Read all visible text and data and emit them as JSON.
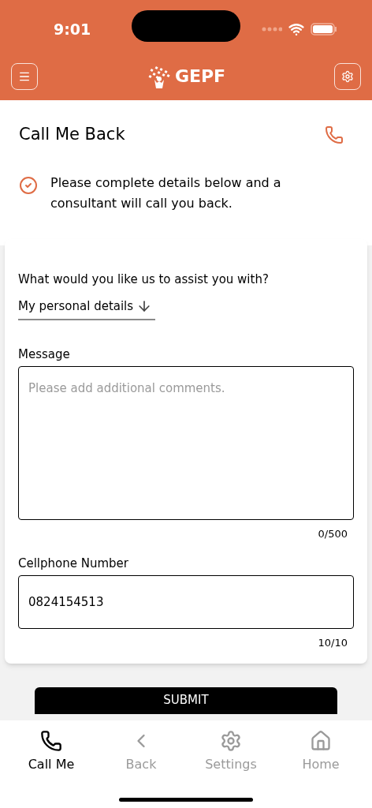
{
  "status_bar": {
    "time": "9:01"
  },
  "header": {
    "logo_text": "GEPF"
  },
  "page": {
    "title": "Call Me Back",
    "notice": "Please complete details below and a consultant will call you back."
  },
  "form": {
    "topic_label": "What would you like us to assist you with?",
    "topic_value": "My personal details",
    "message_label": "Message",
    "message_placeholder": "Please add additional comments.",
    "message_count": "0/500",
    "phone_label": "Cellphone Number",
    "phone_value": "0824154513",
    "phone_count": "10/10"
  },
  "submit": "SUBMIT",
  "tabs": [
    {
      "label": "Call Me",
      "kind": "phone",
      "selected": true
    },
    {
      "label": "Back",
      "kind": "back",
      "selected": false
    },
    {
      "label": "Settings",
      "kind": "gear",
      "selected": false
    },
    {
      "label": "Home",
      "kind": "home",
      "selected": false
    }
  ]
}
